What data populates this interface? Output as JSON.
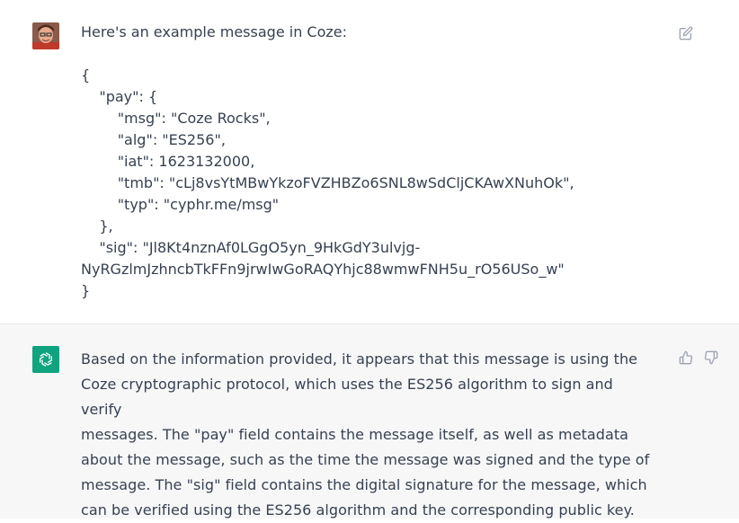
{
  "conversation": {
    "user": {
      "avatar": "user-photo-avatar",
      "message": "Here's an example message in Coze:\n\n{\n    \"pay\": {\n        \"msg\": \"Coze Rocks\",\n        \"alg\": \"ES256\",\n        \"iat\": 1623132000,\n        \"tmb\": \"cLj8vsYtMBwYkzoFVZHBZo6SNL8wSdCljCKAwXNuhOk\",\n        \"typ\": \"cyphr.me/msg\"\n    },\n    \"sig\": \"Jl8Kt4nznAf0LGgO5yn_9HkGdY3ulvjg-\nNyRGzlmJzhncbTkFFn9jrwIwGoRAQYhjc88wmwFNH5u_rO56USo_w\"\n}",
      "actions": {
        "edit_icon": "edit-icon"
      }
    },
    "assistant": {
      "avatar": "openai-logo",
      "avatar_color": "#10a37f",
      "message": "Based on the information provided, it appears that this message is using the\nCoze cryptographic protocol, which uses the ES256 algorithm to sign and verify\nmessages. The \"pay\" field contains the message itself, as well as metadata\nabout the message, such as the time the message was signed and the type of\nmessage. The \"sig\" field contains the digital signature for the message, which\ncan be verified using the ES256 algorithm and the corresponding public key.",
      "actions": {
        "like_icon": "thumbs-up-icon",
        "dislike_icon": "thumbs-down-icon"
      }
    }
  }
}
